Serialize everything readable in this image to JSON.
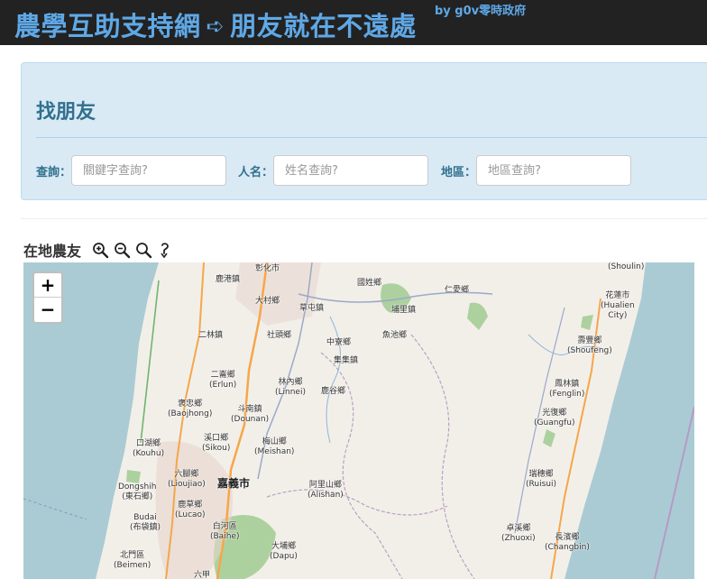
{
  "header": {
    "title_left": "農學互助支持網",
    "arrow": "➪",
    "title_right": "朋友就在不遠處",
    "byline": "by g0v零時政府"
  },
  "search": {
    "heading": "找朋友",
    "keyword": {
      "label": "查詢：",
      "placeholder": "關鍵字查詢?"
    },
    "name": {
      "label": "人名：",
      "placeholder": "姓名查詢?"
    },
    "region": {
      "label": "地區：",
      "placeholder": "地區查詢?"
    }
  },
  "map": {
    "heading": "在地農友",
    "tools": [
      "zoom-in-icon",
      "zoom-out-icon",
      "zoom-reset-icon",
      "pan-hand-icon"
    ],
    "zoom_in": "+",
    "zoom_out": "−",
    "colors": {
      "sea": "#aacbd3",
      "land": "#f2efe9",
      "forest": "#add19e",
      "highway": "#f6a64a",
      "road": "#9aa9c8",
      "border": "#b9a1c4"
    },
    "labels": [
      {
        "text": "彰化市"
      },
      {
        "text": "鹿港鎮"
      },
      {
        "text": "大村鄉"
      },
      {
        "text": "國姓鄉"
      },
      {
        "text": "仁愛鄉"
      },
      {
        "text": "花蓮市\n(Hualien\nCity)"
      },
      {
        "text": "草屯鎮"
      },
      {
        "text": "埔里鎮"
      },
      {
        "text": "二林鎮"
      },
      {
        "text": "社頭鄉"
      },
      {
        "text": "中寮鄉"
      },
      {
        "text": "魚池鄉"
      },
      {
        "text": "壽豐鄉\n(Shoufeng)"
      },
      {
        "text": "集集鎮"
      },
      {
        "text": "二崙鄉\n(Erlun)"
      },
      {
        "text": "林內鄉\n(Linnei)"
      },
      {
        "text": "鹿谷鄉"
      },
      {
        "text": "鳳林鎮\n(Fenglin)"
      },
      {
        "text": "褒忠鄉\n(Baojhong)"
      },
      {
        "text": "斗南鎮\n(Dounan)"
      },
      {
        "text": "光復鄉\n(Guangfu)"
      },
      {
        "text": "口湖鄉\n(Kouhu)"
      },
      {
        "text": "溪口鄉\n(Sikou)"
      },
      {
        "text": "梅山鄉\n(Meishan)"
      },
      {
        "text": "六腳鄉\n(Lioujiao)"
      },
      {
        "text": "嘉義市"
      },
      {
        "text": "瑞穗鄉\n(Ruisui)"
      },
      {
        "text": "Dongshih\n(東石鄉)"
      },
      {
        "text": "阿里山鄉\n(Alishan)"
      },
      {
        "text": "鹿草鄉\n(Lucao)"
      },
      {
        "text": "Budai\n(布袋鎮)"
      },
      {
        "text": "白河區\n(Baihe)"
      },
      {
        "text": "卓溪鄉\n(Zhuoxi)"
      },
      {
        "text": "長濱鄉\n(Changbin)"
      },
      {
        "text": "大埔鄉\n(Dapu)"
      },
      {
        "text": "北門區\n(Beimen)"
      },
      {
        "text": "六甲"
      },
      {
        "text": "(Shoulin)"
      }
    ]
  }
}
